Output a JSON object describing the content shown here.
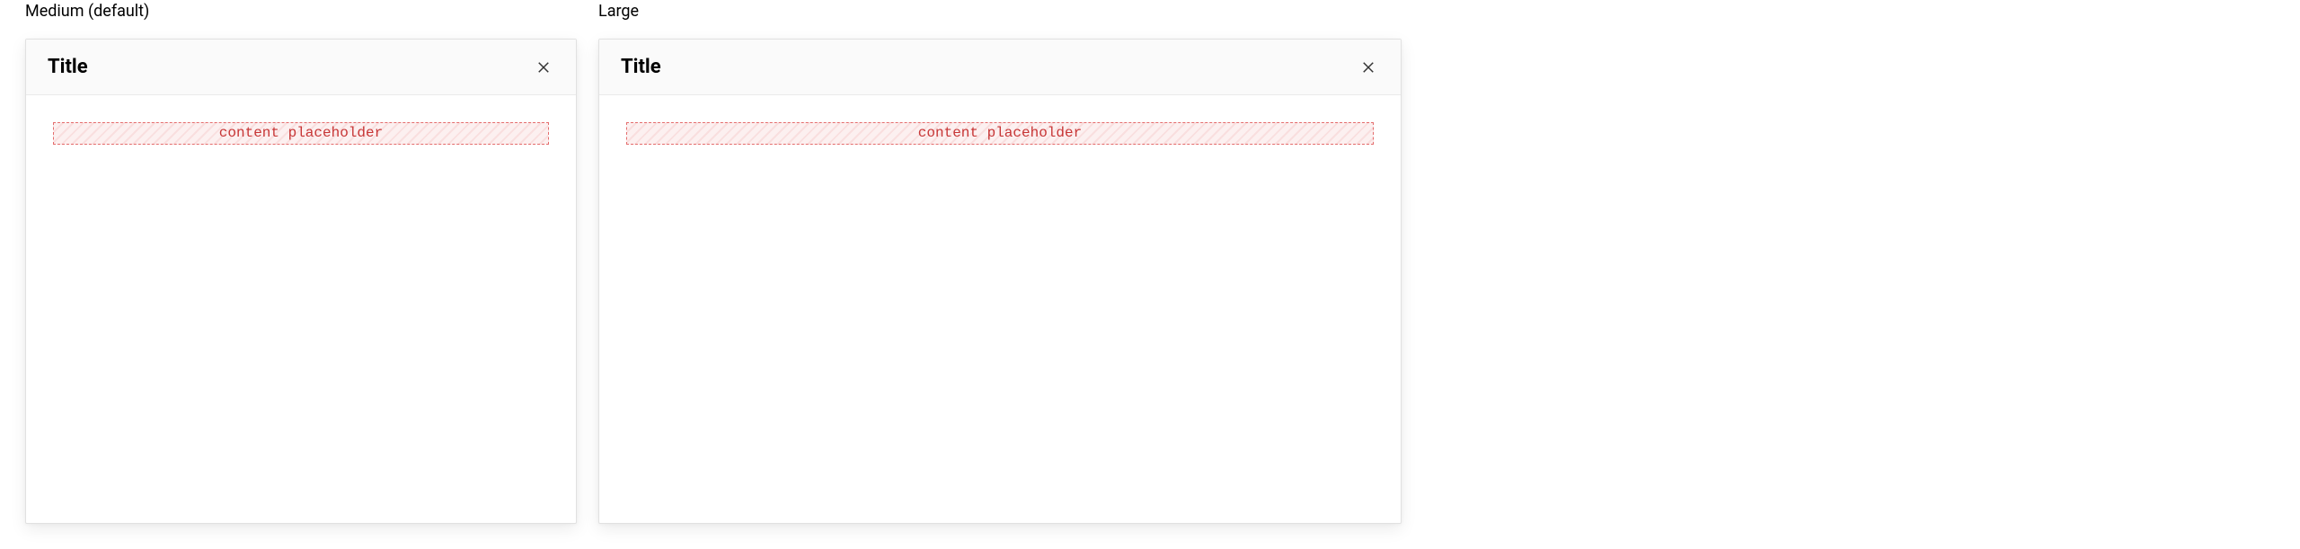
{
  "variants": {
    "medium": {
      "label": "Medium (default)",
      "modal": {
        "title": "Title",
        "placeholder_text": "content placeholder"
      }
    },
    "large": {
      "label": "Large",
      "modal": {
        "title": "Title",
        "placeholder_text": "content placeholder"
      }
    }
  }
}
